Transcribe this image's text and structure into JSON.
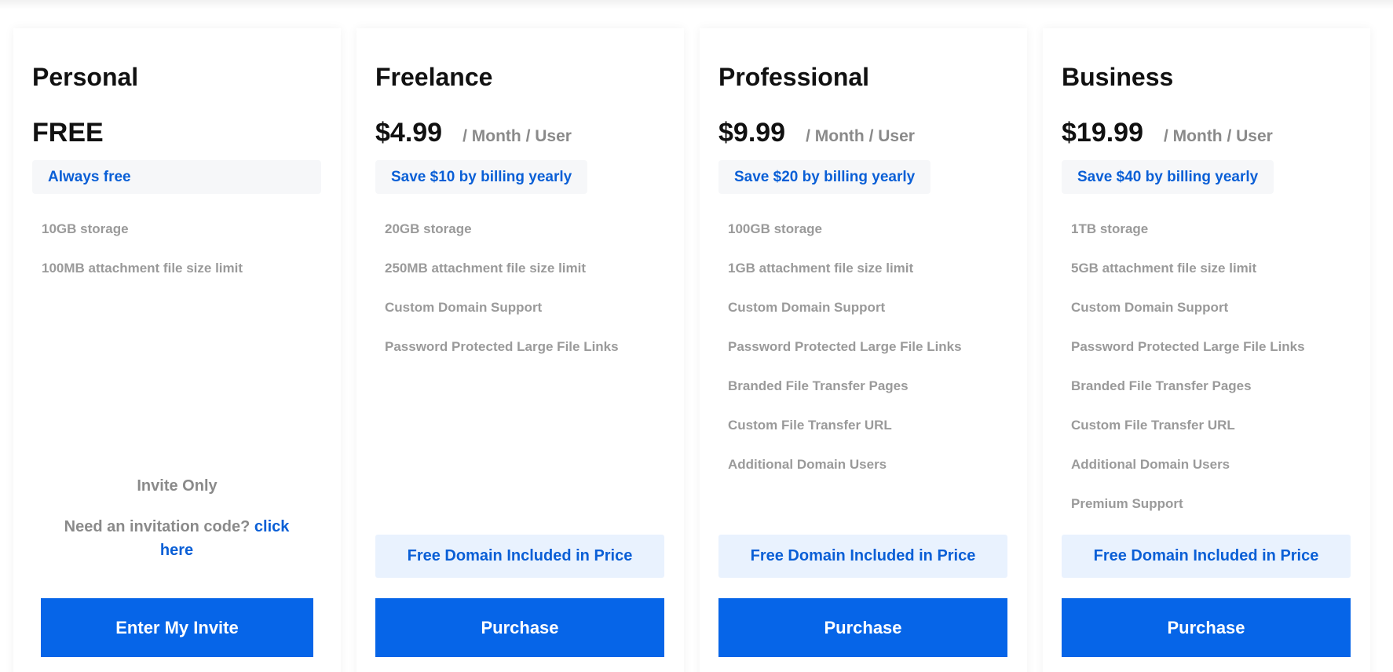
{
  "plans": [
    {
      "name": "Personal",
      "price": "FREE",
      "period": "",
      "savings": "Always free",
      "features": [
        "10GB storage",
        "100MB attachment file size limit"
      ],
      "invite_only": "Invite Only",
      "invite_prompt": "Need an invitation code?",
      "invite_link": "click here",
      "domain_note": "",
      "cta": "Enter My Invite"
    },
    {
      "name": "Freelance",
      "price": "$4.99",
      "period": "/ Month / User",
      "savings": "Save $10 by billing yearly",
      "features": [
        "20GB storage",
        "250MB attachment file size limit",
        "Custom Domain Support",
        "Password Protected Large File Links"
      ],
      "domain_note": "Free Domain Included in Price",
      "cta": "Purchase"
    },
    {
      "name": "Professional",
      "price": "$9.99",
      "period": "/ Month / User",
      "savings": "Save $20 by billing yearly",
      "features": [
        "100GB storage",
        "1GB attachment file size limit",
        "Custom Domain Support",
        "Password Protected Large File Links",
        "Branded File Transfer Pages",
        "Custom File Transfer URL",
        "Additional Domain Users"
      ],
      "domain_note": "Free Domain Included in Price",
      "cta": "Purchase"
    },
    {
      "name": "Business",
      "price": "$19.99",
      "period": "/ Month / User",
      "savings": "Save $40 by billing yearly",
      "features": [
        "1TB storage",
        "5GB attachment file size limit",
        "Custom Domain Support",
        "Password Protected Large File Links",
        "Branded File Transfer Pages",
        "Custom File Transfer URL",
        "Additional Domain Users",
        "Premium Support"
      ],
      "domain_note": "Free Domain Included in Price",
      "cta": "Purchase"
    }
  ],
  "colors": {
    "accent": "#0665e8",
    "link": "#0a5fd6",
    "muted_text": "#9a9a9a",
    "savings_bg": "#f6f7f9",
    "domain_bg": "#e9f2fe"
  }
}
